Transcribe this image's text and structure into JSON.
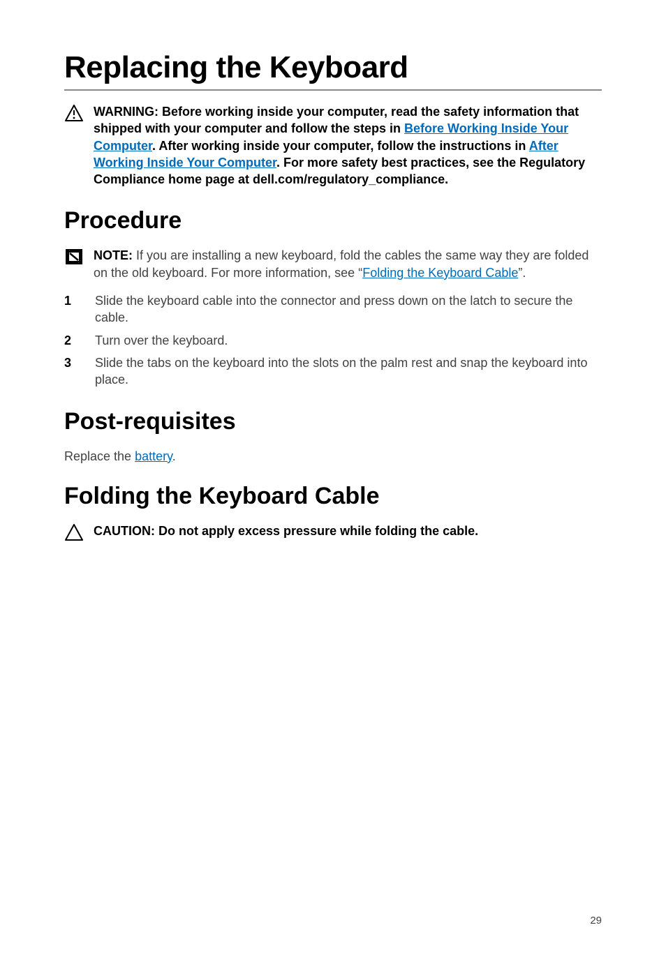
{
  "title": "Replacing the Keyboard",
  "warning": {
    "lead": "WARNING: ",
    "seg1": "Before working inside your computer, read the safety information that shipped with your computer and follow the steps in ",
    "link1": "Before Working Inside Your Computer",
    "seg2": ". After working inside your computer, follow the instructions in ",
    "link2": "After Working Inside Your Computer",
    "seg3": ". For more safety best practices, see the Regulatory Compliance home page at dell.com/regulatory_compliance."
  },
  "procedure": {
    "heading": "Procedure",
    "note": {
      "lead": "NOTE: ",
      "seg1": "If you are installing a new keyboard, fold the cables the same way they are folded on the old keyboard. For more information, see “",
      "link": "Folding the Keyboard Cable",
      "seg2": "”."
    },
    "steps": [
      "Slide the keyboard cable into the connector and press down on the latch to secure the cable.",
      "Turn over the keyboard.",
      "Slide the tabs on the keyboard into the slots on the palm rest and snap the keyboard into place."
    ]
  },
  "postreqs": {
    "heading": "Post-requisites",
    "seg1": "Replace the ",
    "link": "battery",
    "seg2": "."
  },
  "folding": {
    "heading": "Folding the Keyboard Cable",
    "caution": "CAUTION: Do not apply excess pressure while folding the cable."
  },
  "page_number": "29"
}
